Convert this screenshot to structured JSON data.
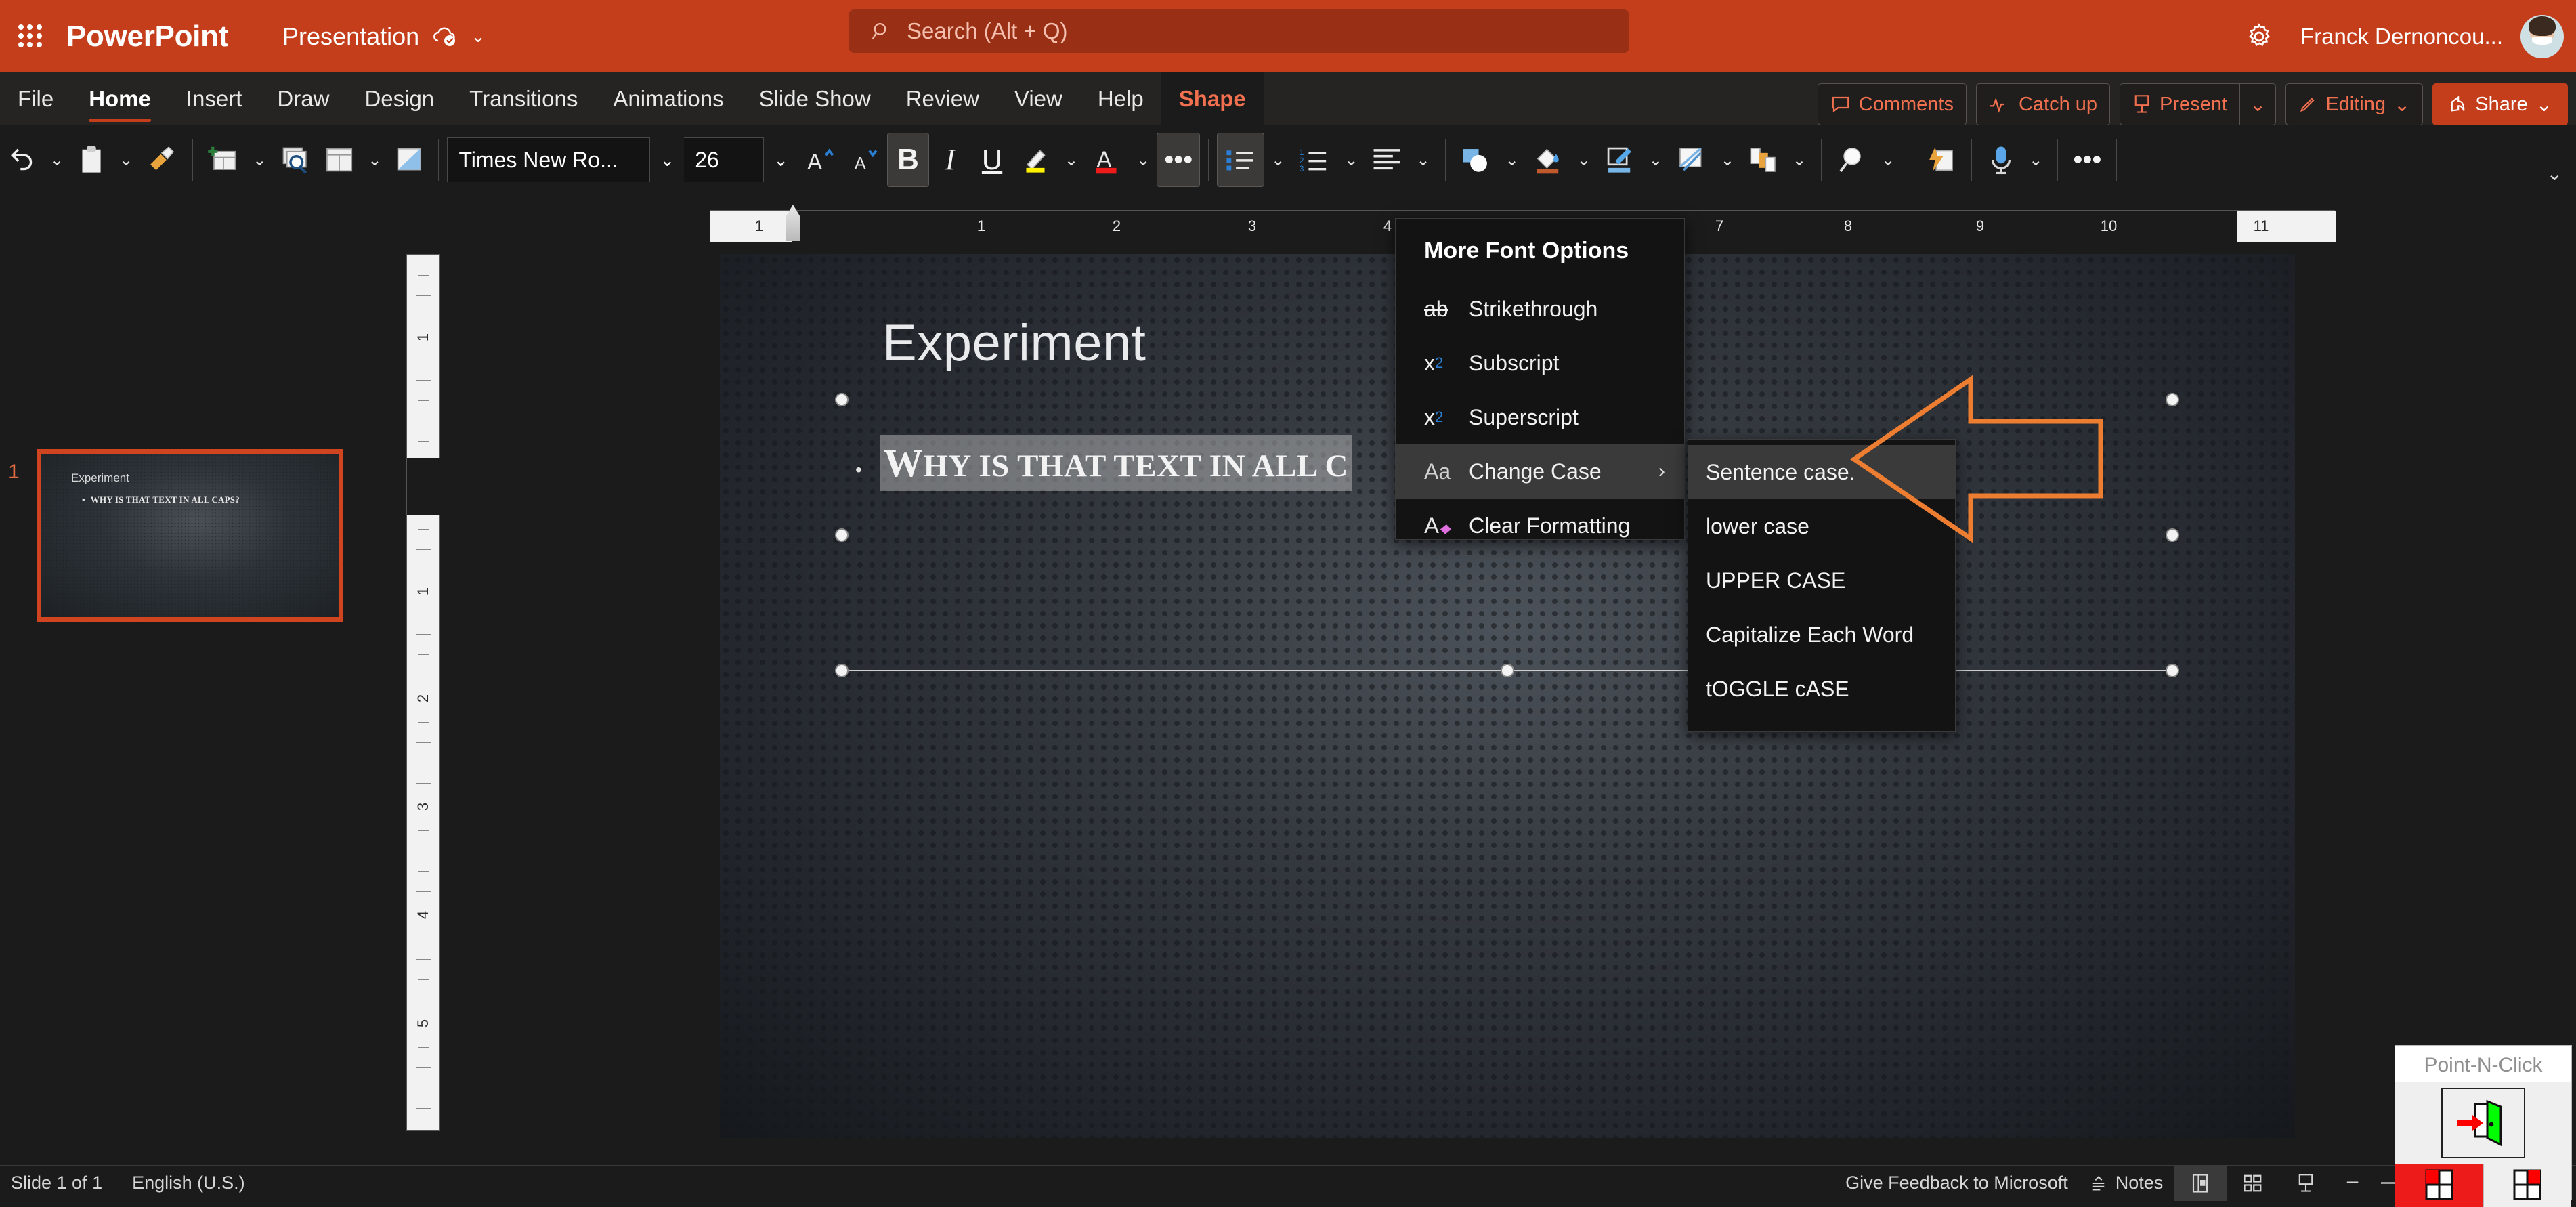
{
  "titlebar": {
    "app_name": "PowerPoint",
    "document_name": "Presentation",
    "waffle_icon": "app-launcher-icon",
    "cloud_icon": "cloud-saved-icon",
    "dropdown_icon": "chevron-down-icon",
    "settings_icon": "gear-icon",
    "user_name": "Franck Dernoncou...",
    "avatar_icon": "user-avatar",
    "brand_color": "#c43e1c"
  },
  "search": {
    "placeholder": "Search (Alt + Q)",
    "icon": "search-icon"
  },
  "ribbon": {
    "tabs": [
      {
        "label": "File",
        "active": false
      },
      {
        "label": "Home",
        "active": true
      },
      {
        "label": "Insert",
        "active": false
      },
      {
        "label": "Draw",
        "active": false
      },
      {
        "label": "Design",
        "active": false
      },
      {
        "label": "Transitions",
        "active": false
      },
      {
        "label": "Animations",
        "active": false
      },
      {
        "label": "Slide Show",
        "active": false
      },
      {
        "label": "Review",
        "active": false
      },
      {
        "label": "View",
        "active": false
      },
      {
        "label": "Help",
        "active": false
      }
    ],
    "contextual_tab": {
      "label": "Shape",
      "color": "#f1704f"
    },
    "actions": {
      "comments": "Comments",
      "comments_icon": "comment-icon",
      "catch_up": "Catch up",
      "catch_up_icon": "activity-icon",
      "present": "Present",
      "present_icon": "present-icon",
      "present_chevron": "chevron-down-icon",
      "editing": "Editing",
      "editing_icon": "pencil-icon",
      "editing_chevron": "chevron-down-icon",
      "share": "Share",
      "share_icon": "share-icon",
      "share_chevron": "chevron-down-icon"
    },
    "collapse_icon": "chevron-down-icon"
  },
  "toolbar": {
    "undo_icon": "undo-icon",
    "paste_icon": "paste-icon",
    "format_painter_icon": "format-painter-icon",
    "new_slide_icon": "new-slide-icon",
    "slide_layout_icon": "slide-preview-icon",
    "layout_icon": "layout-icon",
    "reset_icon": "reset-slide-icon",
    "font_name": "Times New Ro...",
    "font_name_chevron": "chevron-down-icon",
    "font_size": "26",
    "font_size_chevron": "chevron-down-icon",
    "grow_font_icon": "grow-font-icon",
    "shrink_font_icon": "shrink-font-icon",
    "bold_label": "B",
    "bold_active": true,
    "italic_label": "I",
    "underline_label": "U",
    "highlight_icon": "text-highlight-icon",
    "font_color_icon": "font-color-icon",
    "more_font_options_icon": "ellipsis-icon",
    "more_font_options_active": true,
    "bullets_icon": "bullets-icon",
    "bullets_active": true,
    "numbering_icon": "numbering-icon",
    "align_icon": "align-left-icon",
    "shapes_icon": "shapes-icon",
    "shape_fill_icon": "shape-fill-icon",
    "shape_outline_icon": "shape-outline-icon",
    "quick_styles_icon": "quick-styles-icon",
    "arrange_icon": "arrange-icon",
    "find_icon": "find-icon",
    "designer_icon": "designer-icon",
    "dictate_icon": "dictate-icon",
    "overflow_icon": "ellipsis-icon"
  },
  "slides_panel": {
    "slide_number": "1",
    "thumbnail": {
      "title": "Experiment",
      "bullet": "WHY IS THAT TEXT IN ALL CAPS?",
      "bullet_marker": "•"
    },
    "selected_outline_color": "#d14420"
  },
  "rulers": {
    "horizontal_numbers": [
      "1",
      "1",
      "2",
      "3",
      "4",
      "7",
      "8",
      "9",
      "10",
      "11"
    ],
    "vertical_numbers": [
      "1",
      "1",
      "2",
      "3",
      "4",
      "5"
    ],
    "indent_marker_icon": "indent-marker-icon"
  },
  "slide": {
    "title": "Experiment",
    "bullet_marker": "•",
    "bullet_first_letter": "W",
    "bullet_rest": "HY IS THAT TEXT IN ALL C",
    "selection_handles_icon": "resize-handle"
  },
  "font_menu": {
    "heading": "More Font Options",
    "items": [
      {
        "label": "Strikethrough",
        "icon": "strikethrough-icon",
        "glyph": "ab",
        "highlighted": false,
        "submenu": false
      },
      {
        "label": "Subscript",
        "icon": "subscript-icon",
        "glyph": "x₂",
        "highlighted": false,
        "submenu": false
      },
      {
        "label": "Superscript",
        "icon": "superscript-icon",
        "glyph": "x²",
        "highlighted": false,
        "submenu": false
      },
      {
        "label": "Change Case",
        "icon": "change-case-icon",
        "glyph": "Aa",
        "highlighted": true,
        "submenu": true
      },
      {
        "label": "Clear Formatting",
        "icon": "clear-formatting-icon",
        "glyph": "A",
        "highlighted": false,
        "submenu": false
      }
    ],
    "submenu_chevron": "chevron-right-icon"
  },
  "case_submenu": {
    "items": [
      {
        "label": "Sentence case.",
        "highlighted": true
      },
      {
        "label": "lower case",
        "highlighted": false
      },
      {
        "label": "UPPER CASE",
        "highlighted": false
      },
      {
        "label": "Capitalize Each Word",
        "highlighted": false
      },
      {
        "label": "tOGGLE cASE",
        "highlighted": false
      }
    ]
  },
  "annotation": {
    "arrow_icon": "left-pointing-arrow-annotation",
    "color": "#ED7D31"
  },
  "statusbar": {
    "slide_count": "Slide 1 of 1",
    "language": "English (U.S.)",
    "feedback": "Give Feedback to Microsoft",
    "notes": "Notes",
    "notes_icon": "notes-icon",
    "view_normal_icon": "normal-view-icon",
    "view_sorter_icon": "slide-sorter-icon",
    "view_reading_icon": "reading-view-icon",
    "zoom_out_icon": "minus-icon",
    "zoom_in_icon": "plus-icon",
    "zoom_slider_icon": "zoom-slider"
  },
  "point_n_click": {
    "title": "Point-N-Click",
    "exit_icon": "exit-door-icon",
    "left_icon": "red-window-icon",
    "right_icon": "white-window-icon"
  }
}
